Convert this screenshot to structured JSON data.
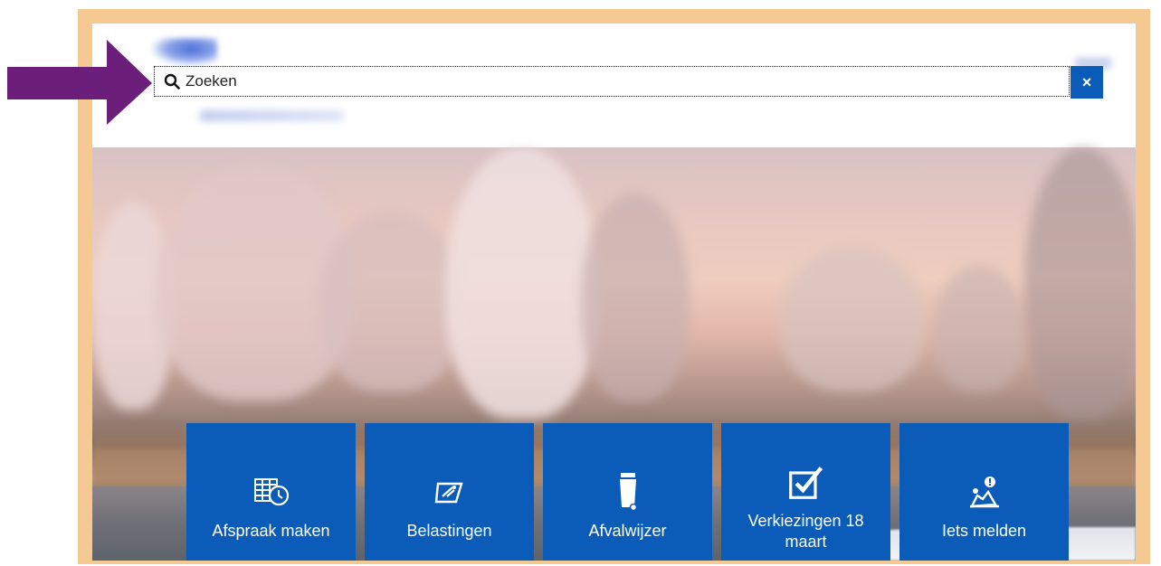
{
  "search": {
    "placeholder": "Zoeken",
    "close_label": "×"
  },
  "tiles": [
    {
      "label": "Afspraak maken",
      "icon": "calendar-clock-icon"
    },
    {
      "label": "Belastingen",
      "icon": "tax-form-icon"
    },
    {
      "label": "Afvalwijzer",
      "icon": "waste-bin-icon"
    },
    {
      "label": "Verkiezingen 18 maart",
      "icon": "checkbox-icon"
    },
    {
      "label": "Iets melden",
      "icon": "report-issue-icon"
    }
  ],
  "colors": {
    "tile": "#0b5cb8",
    "frame": "#f5c992",
    "arrow": "#6b1f7a"
  }
}
